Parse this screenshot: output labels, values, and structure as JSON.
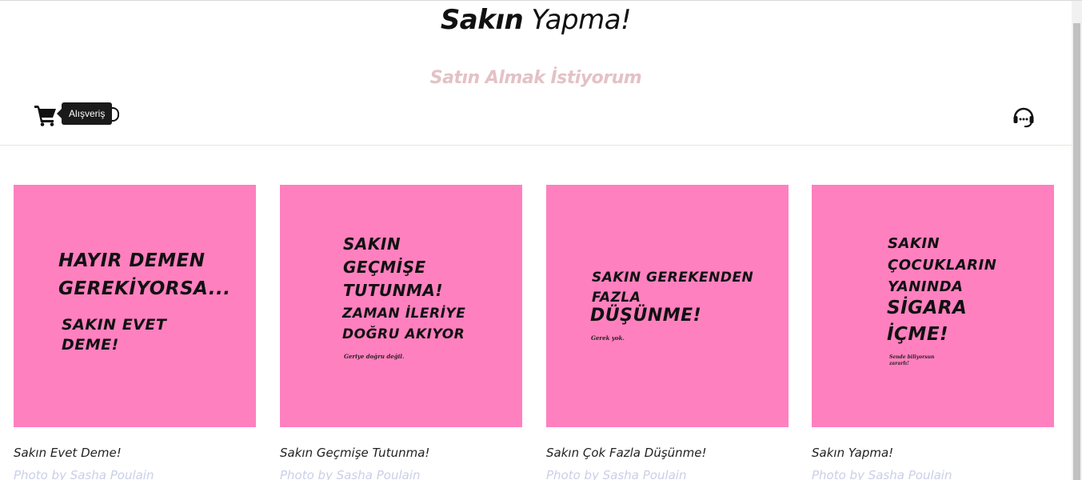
{
  "header": {
    "title_bold": "Sakın",
    "title_rest": "Yapma!",
    "subtitle": "Satın Almak İstiyorum",
    "cart_tooltip": "Alışveriş",
    "cart_icon": "shopping-cart-icon",
    "support_icon": "headset-icon"
  },
  "colors": {
    "poster_background": "#ff80bf",
    "subtitle": "#e3c2c6",
    "credit": "#c9cfe8",
    "tooltip_background": "#1a1a1a"
  },
  "products": [
    {
      "title": "Sakın Evet Deme!",
      "credit": "Photo by Sasha Poulain",
      "poster_main": "HAYIR DEMEN\nGEREKİYORSA...",
      "poster_secondary": "SAKIN EVET\nDEME!",
      "poster_small": ""
    },
    {
      "title": "Sakın Geçmişe Tutunma!",
      "credit": "Photo by Sasha Poulain",
      "poster_main": "SAKIN\nGEÇMİŞE\nTUTUNMA!",
      "poster_secondary": "ZAMAN İLERİYE\nDOĞRU AKIYOR",
      "poster_small": "Geriye doğru değil."
    },
    {
      "title": "Sakın Çok Fazla Düşünme!",
      "credit": "Photo by Sasha Poulain",
      "poster_main": "SAKIN GEREKENDEN\nFAZLA",
      "poster_secondary": "DÜŞÜNME!",
      "poster_small": "Gerek yok."
    },
    {
      "title": "Sakın Yapma!",
      "credit": "Photo by Sasha Poulain",
      "poster_main": "SAKIN\nÇOCUKLARIN\nYANINDA",
      "poster_secondary": "SİGARA\nİÇME!",
      "poster_small": "Sende biliyorsun\nzararlı!"
    }
  ]
}
